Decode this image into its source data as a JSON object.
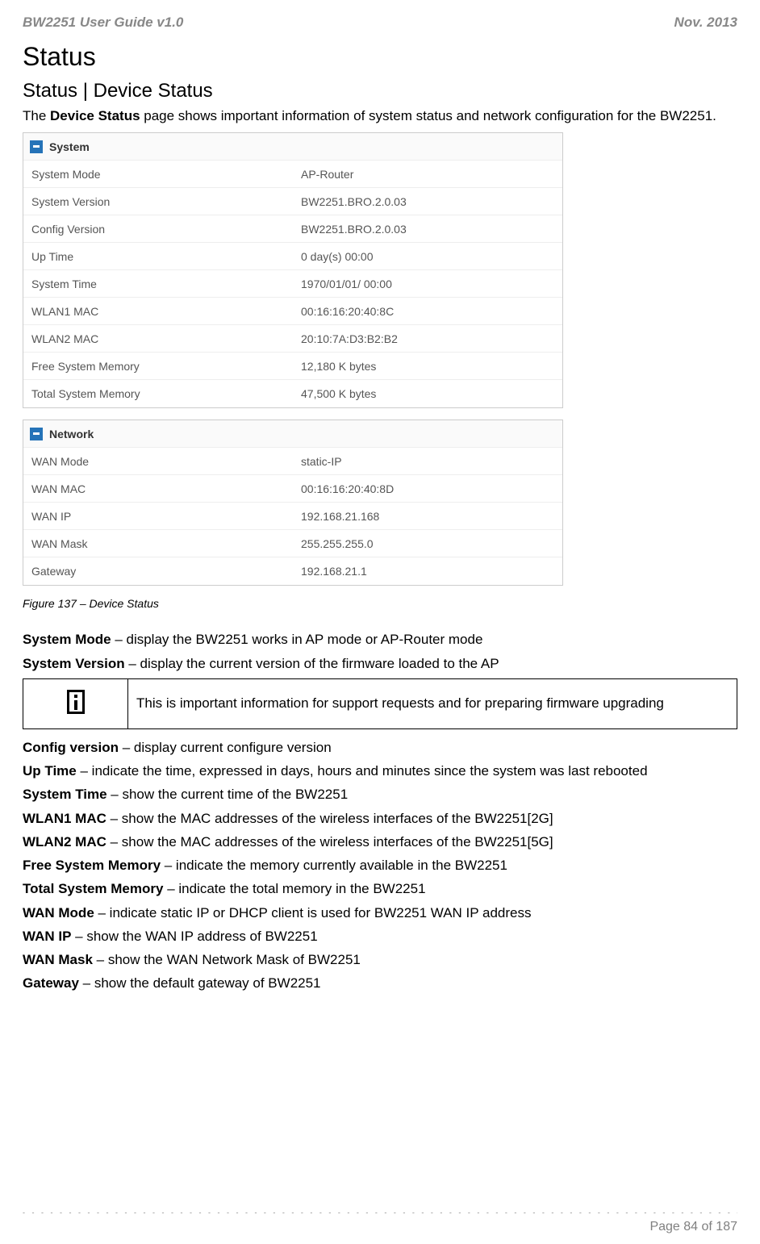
{
  "header": {
    "left": "BW2251 User Guide v1.0",
    "right": "Nov.  2013"
  },
  "h1": "Status",
  "h2": "Status | Device Status",
  "intro_pre": "The ",
  "intro_bold": "Device Status",
  "intro_post": " page shows important information of system status and network configuration for the BW2251.",
  "system": {
    "title": "System",
    "rows": [
      {
        "k": "System Mode",
        "v": "AP-Router"
      },
      {
        "k": "System Version",
        "v": "BW2251.BRO.2.0.03"
      },
      {
        "k": "Config Version",
        "v": "BW2251.BRO.2.0.03"
      },
      {
        "k": "Up Time",
        "v": "0 day(s) 00:00"
      },
      {
        "k": "System Time",
        "v": "1970/01/01/ 00:00"
      },
      {
        "k": "WLAN1 MAC",
        "v": "00:16:16:20:40:8C"
      },
      {
        "k": "WLAN2 MAC",
        "v": "20:10:7A:D3:B2:B2"
      },
      {
        "k": "Free System Memory",
        "v": "12,180 K bytes"
      },
      {
        "k": "Total System Memory",
        "v": "47,500 K bytes"
      }
    ]
  },
  "network": {
    "title": "Network",
    "rows": [
      {
        "k": "WAN Mode",
        "v": "static-IP"
      },
      {
        "k": "WAN MAC",
        "v": "00:16:16:20:40:8D"
      },
      {
        "k": "WAN IP",
        "v": "192.168.21.168"
      },
      {
        "k": "WAN Mask",
        "v": "255.255.255.0"
      },
      {
        "k": "Gateway",
        "v": "192.168.21.1"
      }
    ]
  },
  "caption": "Figure 137  – Device Status",
  "defs": [
    {
      "b": "System Mode",
      "t": " – display the BW2251 works in AP mode or AP-Router mode"
    },
    {
      "b": "System Version",
      "t": " – display the current version of the firmware loaded to the AP"
    }
  ],
  "note": "This is important information for support requests and for preparing firmware upgrading",
  "defs2": [
    {
      "b": "Config version",
      "t": " – display current configure version"
    },
    {
      "b": "Up Time",
      "t": " – indicate the time, expressed in days, hours and minutes since the system was last rebooted"
    },
    {
      "b": "System Time",
      "t": " – show the current time of the BW2251"
    },
    {
      "b": "WLAN1 MAC",
      "t": " – show the MAC addresses of the wireless interfaces of the BW2251[2G]"
    },
    {
      "b": "WLAN2 MAC",
      "t": " – show the MAC addresses of the wireless interfaces of the BW2251[5G]"
    },
    {
      "b": "Free System Memory",
      "t": " – indicate the memory currently available in the BW2251"
    },
    {
      "b": "Total System Memory",
      "t": " – indicate the total memory in the BW2251"
    },
    {
      "b": "WAN Mode",
      "t": " – indicate static IP or DHCP client is used for BW2251 WAN IP address"
    },
    {
      "b": "WAN IP",
      "t": " – show the WAN IP address of BW2251"
    },
    {
      "b": "WAN Mask",
      "t": " – show the WAN Network Mask of BW2251"
    },
    {
      "b": "Gateway",
      "t": " – show the default gateway of BW2251"
    }
  ],
  "footer": {
    "page": "Page 84 of 187"
  }
}
